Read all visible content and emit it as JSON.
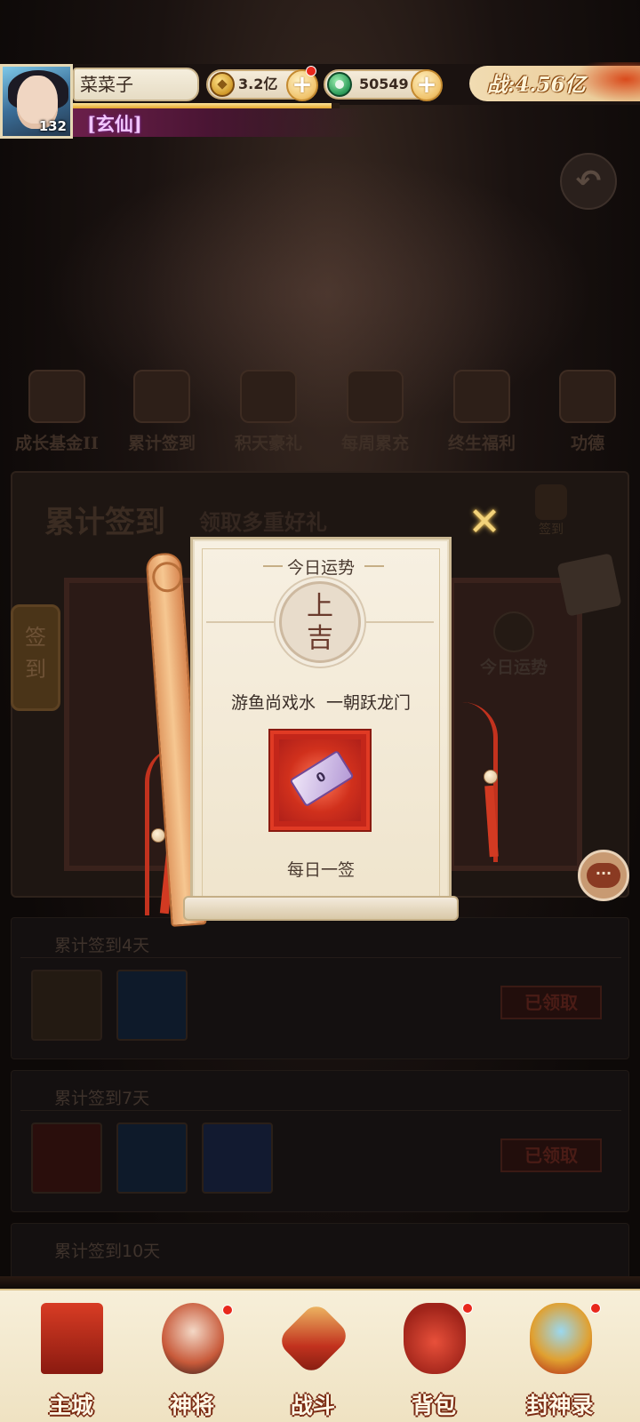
{
  "hud": {
    "player_name": "菜菜子",
    "level": "132",
    "rank": "[玄仙]",
    "exp_fraction": 0.97,
    "coins": "3.2亿",
    "jade": "50549",
    "power": "战:4.56亿",
    "plus_symbol": "+"
  },
  "background": {
    "back_icon": "back-arrow-icon",
    "tabs": [
      "成长基金II",
      "累计签到",
      "积天豪礼",
      "每周累充",
      "终生福利",
      "功德"
    ],
    "panel_title": "累计签到",
    "panel_subtitle": "领取多重好礼",
    "top_sign_label": "签到",
    "side_sign_label": "签到",
    "daily_fortune_label": "今日运势",
    "rows": [
      {
        "title": "累计签到4天",
        "status": "已领取"
      },
      {
        "title": "累计签到7天",
        "status": "已领取"
      },
      {
        "title": "累计签到10天",
        "status": ""
      }
    ]
  },
  "modal": {
    "title": "今日运势",
    "fortune_char_1": "上",
    "fortune_char_2": "吉",
    "fortune_text": "游鱼尚戏水  一朝跃龙门",
    "item_label": "0",
    "daily_label": "每日一签",
    "close_symbol": "✕"
  },
  "bottom_nav": [
    {
      "label": "主城",
      "icon": "city-gate-icon"
    },
    {
      "label": "神将",
      "icon": "hero-icon"
    },
    {
      "label": "战斗",
      "icon": "crossed-swords-icon"
    },
    {
      "label": "背包",
      "icon": "bag-icon"
    },
    {
      "label": "封神录",
      "icon": "scroll-book-icon"
    }
  ],
  "colors": {
    "accent_red": "#c3261a",
    "gold": "#f2d27a",
    "parchment": "#f7f0e2",
    "rank_purple": "#f2c6ff"
  }
}
